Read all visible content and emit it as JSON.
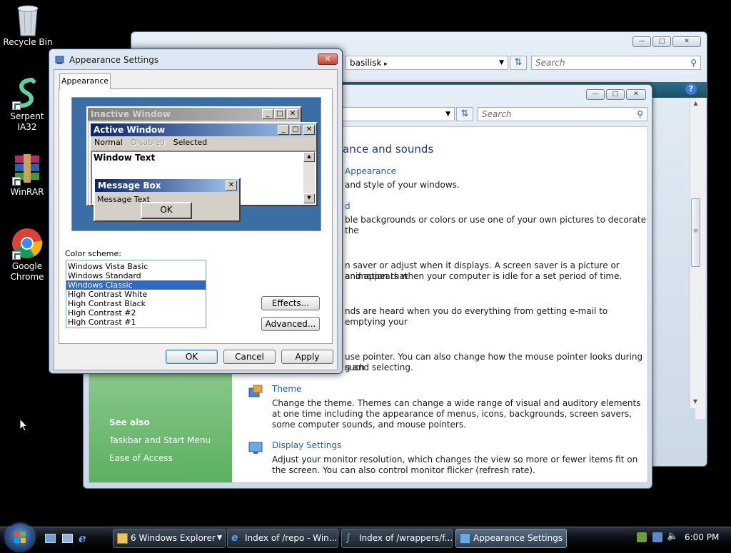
{
  "desktop": {
    "icons": [
      {
        "label": "Recycle Bin"
      },
      {
        "label": "Serpent IA32"
      },
      {
        "label": "WinRAR"
      },
      {
        "label": "Google Chrome"
      }
    ]
  },
  "back_window": {
    "address_segment": "basilisk",
    "search_placeholder": "Search"
  },
  "front_explorer": {
    "search_placeholder": "Search",
    "heading_partial": "ance and sounds",
    "items": [
      {
        "title_partial": "Appearance",
        "desc": "and style of your windows."
      },
      {
        "title_partial": "d",
        "desc": "ble backgrounds or colors or use one of your own pictures to decorate the"
      },
      {
        "desc": "n saver or adjust when it displays. A screen saver is a picture or animation that"
      },
      {
        "desc2": "and appears when your computer is idle for a set period of time."
      },
      {
        "desc": "nds are heard when you do everything from getting e-mail to emptying your"
      },
      {
        "desc": "use pointer. You can also change how the mouse pointer looks during such"
      },
      {
        "desc2": "g and selecting."
      }
    ],
    "theme": {
      "title": "Theme",
      "desc": "Change the theme. Themes can change a wide range of visual and auditory elements at one time including the appearance of menus, icons, backgrounds, screen savers, some computer sounds, and mouse pointers."
    },
    "display": {
      "title": "Display Settings",
      "desc": "Adjust your monitor resolution, which changes the view so more or fewer items fit on the screen. You can also control monitor flicker (refresh rate)."
    },
    "see_also": {
      "heading": "See also",
      "links": [
        "Taskbar and Start Menu",
        "Ease of Access"
      ]
    }
  },
  "dialog": {
    "title": "Appearance Settings",
    "tab": "Appearance",
    "preview": {
      "inactive_title": "Inactive Window",
      "active_title": "Active Window",
      "menu": [
        "Normal",
        "Disabled",
        "Selected"
      ],
      "window_text": "Window Text",
      "msgbox_title": "Message Box",
      "msgbox_text": "Message Text",
      "ok": "OK"
    },
    "color_scheme_label": "Color scheme:",
    "schemes": [
      "Windows Vista Basic",
      "Windows Standard",
      "Windows Classic",
      "High Contrast White",
      "High Contrast Black",
      "High Contrast #2",
      "High Contrast #1"
    ],
    "selected_scheme": "Windows Classic",
    "effects_btn": "Effects...",
    "advanced_btn": "Advanced...",
    "ok_btn": "OK",
    "cancel_btn": "Cancel",
    "apply_btn": "Apply"
  },
  "taskbar": {
    "buttons": [
      {
        "label": "6 Windows Explorer"
      },
      {
        "label": "Index of /repo - Win..."
      },
      {
        "label": "Index of /wrappers/f..."
      },
      {
        "label": "Appearance Settings"
      }
    ],
    "clock": "6:00 PM"
  },
  "colors": {
    "classic_title_active": "#0a246a",
    "preview_bg": "#3a6ea5",
    "sidebar_green": "#5bb15f",
    "link_blue": "#1e5eb0"
  }
}
